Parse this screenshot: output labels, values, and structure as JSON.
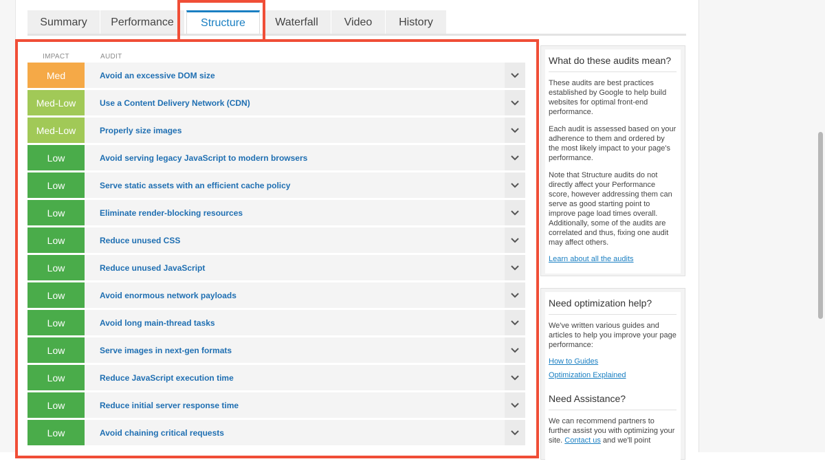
{
  "tabs": [
    {
      "label": "Summary"
    },
    {
      "label": "Performance"
    },
    {
      "label": "Structure"
    },
    {
      "label": "Waterfall"
    },
    {
      "label": "Video"
    },
    {
      "label": "History"
    }
  ],
  "active_tab": "Structure",
  "table": {
    "impact_header": "IMPACT",
    "audit_header": "AUDIT"
  },
  "impact_colors": {
    "Med": "#f5a947",
    "Med-Low": "#a1c957",
    "Low": "#4aac4a"
  },
  "audits": [
    {
      "impact": "Med",
      "title": "Avoid an excessive DOM size"
    },
    {
      "impact": "Med-Low",
      "title": "Use a Content Delivery Network (CDN)"
    },
    {
      "impact": "Med-Low",
      "title": "Properly size images"
    },
    {
      "impact": "Low",
      "title": "Avoid serving legacy JavaScript to modern browsers"
    },
    {
      "impact": "Low",
      "title": "Serve static assets with an efficient cache policy"
    },
    {
      "impact": "Low",
      "title": "Eliminate render-blocking resources"
    },
    {
      "impact": "Low",
      "title": "Reduce unused CSS"
    },
    {
      "impact": "Low",
      "title": "Reduce unused JavaScript"
    },
    {
      "impact": "Low",
      "title": "Avoid enormous network payloads"
    },
    {
      "impact": "Low",
      "title": "Avoid long main-thread tasks"
    },
    {
      "impact": "Low",
      "title": "Serve images in next-gen formats"
    },
    {
      "impact": "Low",
      "title": "Reduce JavaScript execution time"
    },
    {
      "impact": "Low",
      "title": "Reduce initial server response time"
    },
    {
      "impact": "Low",
      "title": "Avoid chaining critical requests"
    }
  ],
  "sidebar": {
    "audits_box": {
      "heading": "What do these audits mean?",
      "p1": "These audits are best practices established by Google to help build websites for optimal front-end performance.",
      "p2": "Each audit is assessed based on your adherence to them and ordered by the most likely impact to your page's performance.",
      "p3": "Note that Structure audits do not directly affect your Performance score, however addressing them can serve as good starting point to improve page load times overall. Additionally, some of the audits are correlated and thus, fixing one audit may affect others.",
      "link": "Learn about all the audits"
    },
    "help_box": {
      "heading": "Need optimization help?",
      "p1": "We've written various guides and articles to help you improve your page performance:",
      "link1": "How to Guides",
      "link2": "Optimization Explained",
      "heading2": "Need Assistance?",
      "p2_start": "We can recommend partners to further assist you with optimizing your site.",
      "p2_link": "Contact us",
      "p2_end": "and we'll point"
    }
  }
}
